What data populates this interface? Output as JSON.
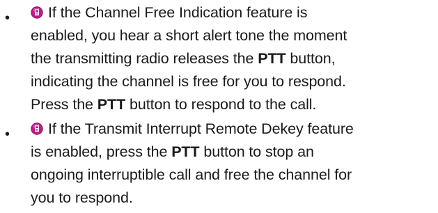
{
  "bullets": [
    {
      "marker": "•",
      "icon": "conventional-mode-icon",
      "lines": [
        {
          "pre": "If the Channel Free Indication feature is"
        },
        {
          "pre": "enabled, you hear a short alert tone the moment"
        },
        {
          "pre": "the transmitting radio releases the ",
          "bold": "PTT",
          "post": " button,"
        },
        {
          "pre": "indicating the channel is free for you to respond."
        },
        {
          "pre": "Press the ",
          "bold": "PTT",
          "post": " button to respond to the call."
        }
      ]
    },
    {
      "marker": "•",
      "icon": "conventional-mode-icon",
      "lines": [
        {
          "pre": "If the Transmit Interrupt Remote Dekey feature"
        },
        {
          "pre": "is enabled, press the ",
          "bold": "PTT",
          "post": " button to stop an"
        },
        {
          "pre": "ongoing interruptible call and free the channel for"
        },
        {
          "pre": "you to respond."
        }
      ]
    }
  ],
  "colors": {
    "text": "#1a1a1a",
    "icon_fill": "#c21a8a",
    "icon_edge": "#8e1264",
    "icon_glyph": "#ffffff"
  }
}
